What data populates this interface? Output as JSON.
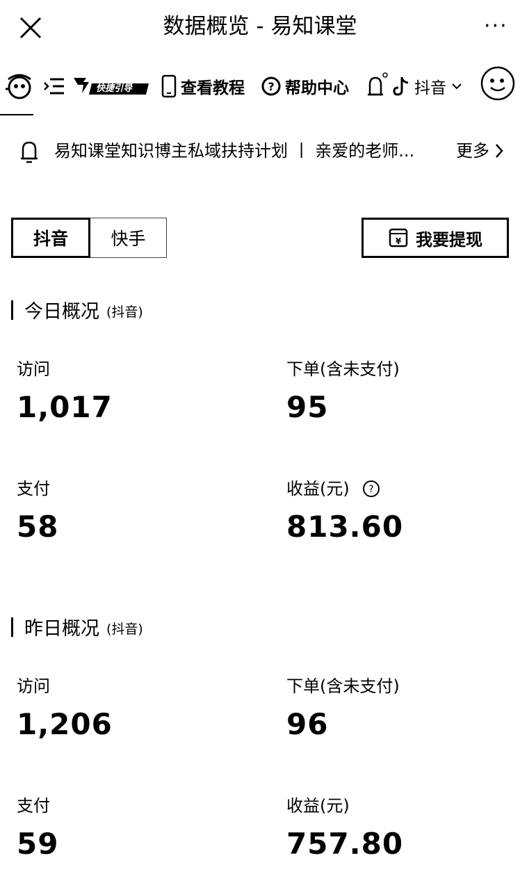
{
  "titlebar": {
    "title": "数据概览 - 易知课堂",
    "more": "···"
  },
  "toolbar": {
    "badge_text": "快捷引导",
    "tutorial": "查看教程",
    "help": "帮助中心",
    "platform": "抖音"
  },
  "notice": {
    "text": "易知课堂知识博主私域扶持计划 丨 亲爱的老师...",
    "more": "更多"
  },
  "tabs": [
    "抖音",
    "快手"
  ],
  "withdraw_label": "我要提现",
  "today": {
    "title": "今日概况",
    "platform": "(抖音)",
    "visits_label": "访问",
    "visits": "1,017",
    "orders_label": "下单(含未支付)",
    "orders": "95",
    "paid_label": "支付",
    "paid": "58",
    "revenue_label": "收益(元)",
    "revenue": "813.60"
  },
  "yesterday": {
    "title": "昨日概况",
    "platform": "(抖音)",
    "visits_label": "访问",
    "visits": "1,206",
    "orders_label": "下单(含未支付)",
    "orders": "96",
    "paid_label": "支付",
    "paid": "59",
    "revenue_label": "收益(元)",
    "revenue": "757.80"
  }
}
